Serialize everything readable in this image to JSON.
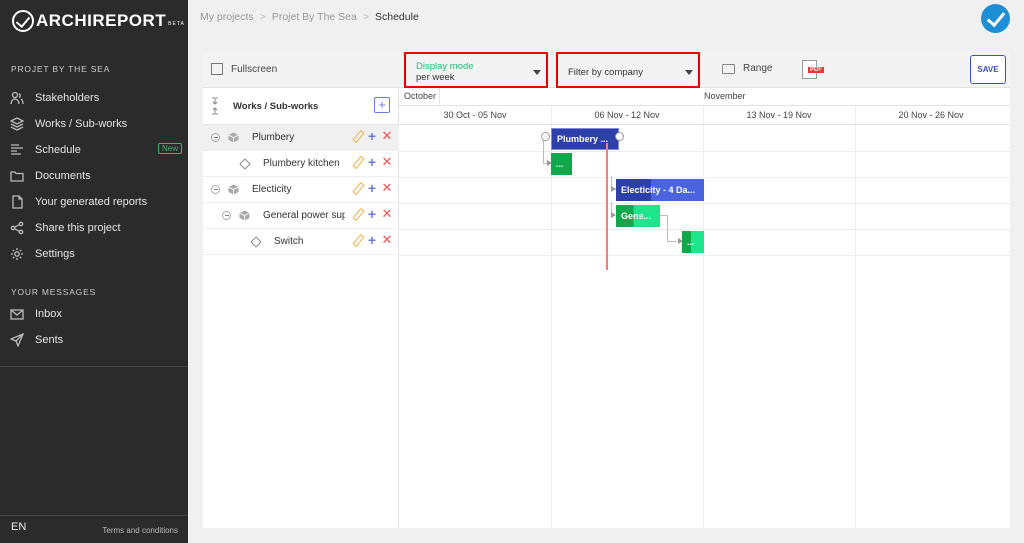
{
  "sidebar": {
    "logo": "ARCHIREPORT",
    "logo_badge": "BETA",
    "project_section": "PROJET BY THE SEA",
    "nav": [
      {
        "label": "Stakeholders",
        "icon": "users-icon"
      },
      {
        "label": "Works / Sub-works",
        "icon": "layers-icon"
      },
      {
        "label": "Schedule",
        "icon": "schedule-icon",
        "badge": "New"
      },
      {
        "label": "Documents",
        "icon": "folder-icon"
      },
      {
        "label": "Your generated reports",
        "icon": "file-icon"
      },
      {
        "label": "Share this project",
        "icon": "share-icon"
      },
      {
        "label": "Settings",
        "icon": "gear-icon"
      }
    ],
    "messages_section": "YOUR MESSAGES",
    "messages": [
      {
        "label": "Inbox",
        "icon": "inbox-icon"
      },
      {
        "label": "Sents",
        "icon": "send-icon"
      }
    ],
    "language": "EN",
    "terms": "Terms and conditions"
  },
  "breadcrumb": {
    "items": [
      "My projects",
      "Projet By The Sea",
      "Schedule"
    ],
    "separator": ">"
  },
  "toolbar": {
    "fullscreen": "Fullscreen",
    "display_mode_label": "Display mode",
    "display_mode_value": "per week",
    "filter_placeholder": "Filter by company",
    "range": "Range",
    "pdf_tag": "PDF",
    "save": "SAVE"
  },
  "tree": {
    "header": "Works / Sub-works",
    "add_symbol": "+",
    "rows": [
      {
        "name": "Plumbery",
        "type": "work",
        "level": 0
      },
      {
        "name": "Plumbery kitchen",
        "type": "subwork",
        "level": 1
      },
      {
        "name": "Electicity",
        "type": "work",
        "level": 0
      },
      {
        "name": "General power sup",
        "type": "work",
        "level": 1
      },
      {
        "name": "Switch",
        "type": "subwork",
        "level": 2
      }
    ]
  },
  "timeline": {
    "months": [
      "October",
      "November"
    ],
    "weeks": [
      "30 Oct - 05 Nov",
      "06 Nov - 12 Nov",
      "13 Nov - 19 Nov",
      "20 Nov - 26 Nov"
    ]
  },
  "bars": [
    {
      "label": "Plumbery ...",
      "color": "#2d3fa8"
    },
    {
      "label": "...",
      "color": "#0fa84b"
    },
    {
      "label": "Electicity - 4 Da...",
      "color": "#2d3fa8",
      "progress_color": "#4a64e0"
    },
    {
      "label": "Gene...",
      "color": "#0fa84b",
      "progress_color": "#1ee58c"
    },
    {
      "label": "...",
      "color": "#0fa84b",
      "progress_color": "#1ee58c"
    }
  ],
  "colors": {
    "sidebar_bg": "#2b2b2b",
    "accent_blue": "#3b4fc4",
    "accent_green": "#1fbf7a",
    "highlight_red": "#e00000",
    "today_line": "#f07f7f",
    "check_button": "#1e8fd6"
  }
}
